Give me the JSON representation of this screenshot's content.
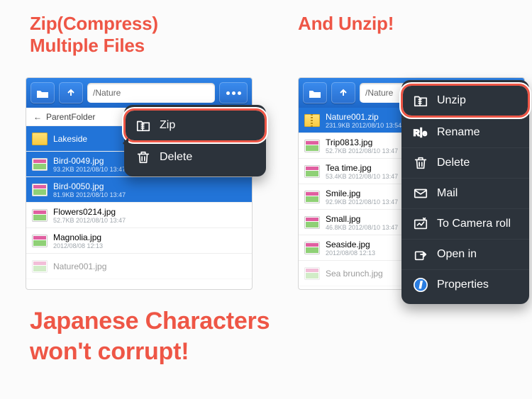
{
  "headlines": {
    "left_line1": "Zip(Compress)",
    "left_line2": "Multiple Files",
    "right": "And Unzip!",
    "bottom_line1": "Japanese Characters",
    "bottom_line2": "won't corrupt!"
  },
  "panel_left": {
    "path": "/Nature",
    "crumb": "ParentFolder",
    "rows": [
      {
        "name": "Lakeside",
        "type": "folder",
        "selected": true
      },
      {
        "name": "Bird-0049.jpg",
        "meta": "93.2KB  2012/08/10 13:47",
        "type": "img",
        "selected": true
      },
      {
        "name": "Bird-0050.jpg",
        "meta": "81.9KB  2012/08/10 13:47",
        "type": "img",
        "selected": true
      },
      {
        "name": "Flowers0214.jpg",
        "meta": "52.7KB  2012/08/10 13:47",
        "type": "img"
      },
      {
        "name": "Magnolia.jpg",
        "meta": "2012/08/08 12:13",
        "type": "img"
      },
      {
        "name": "Nature001.jpg",
        "meta": "",
        "type": "img",
        "dim": true
      }
    ]
  },
  "panel_right": {
    "path": "/Nature",
    "rows": [
      {
        "name": "Nature001.zip",
        "meta": "231.9KB  2012/08/10 13:54",
        "type": "zip",
        "selected": true
      },
      {
        "name": "Trip0813.jpg",
        "meta": "52.7KB  2012/08/10 13:47",
        "type": "img"
      },
      {
        "name": "Tea time.jpg",
        "meta": "53.4KB  2012/08/10 13:47",
        "type": "img"
      },
      {
        "name": "Smile.jpg",
        "meta": "92.9KB  2012/08/10 13:47",
        "type": "img"
      },
      {
        "name": "Small.jpg",
        "meta": "46.8KB  2012/08/10 13:47",
        "type": "img"
      },
      {
        "name": "Seaside.jpg",
        "meta": "2012/08/08 12:13",
        "type": "img"
      },
      {
        "name": "Sea brunch.jpg",
        "meta": "",
        "type": "img",
        "dim": true
      }
    ]
  },
  "menu_left": {
    "items": [
      {
        "label": "Zip",
        "icon": "zip",
        "highlight": true
      },
      {
        "label": "Delete",
        "icon": "trash"
      }
    ]
  },
  "menu_right": {
    "items": [
      {
        "label": "Unzip",
        "icon": "zip",
        "highlight": true
      },
      {
        "label": "Rename",
        "icon": "rename"
      },
      {
        "label": "Delete",
        "icon": "trash"
      },
      {
        "label": "Mail",
        "icon": "mail"
      },
      {
        "label": "To Camera roll",
        "icon": "camera"
      },
      {
        "label": "Open in",
        "icon": "share"
      },
      {
        "label": "Properties",
        "icon": "info"
      }
    ]
  }
}
